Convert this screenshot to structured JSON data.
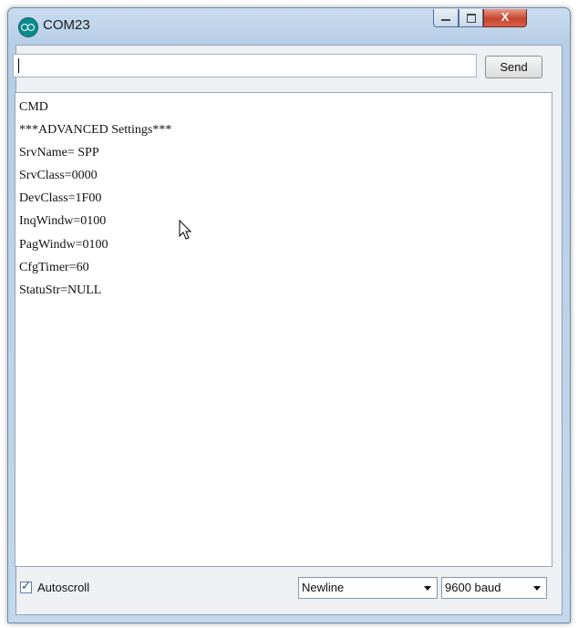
{
  "window": {
    "title": "COM23",
    "icon": "arduino-logo-icon",
    "controls": {
      "minimize": "minimize-icon",
      "maximize": "maximize-icon",
      "close": "X"
    }
  },
  "input": {
    "value": "",
    "send_label": "Send"
  },
  "output": {
    "lines": [
      "CMD",
      "***ADVANCED Settings***",
      "SrvName= SPP",
      "SrvClass=0000",
      "DevClass=1F00",
      "InqWindw=0100",
      "PagWindw=0100",
      "CfgTimer=60",
      "StatuStr=NULL"
    ]
  },
  "footer": {
    "autoscroll_label": "Autoscroll",
    "autoscroll_checked": true,
    "line_ending": "Newline",
    "baud_rate": "9600 baud"
  },
  "colors": {
    "title_bar": "#c3d8ec",
    "close_button": "#c6452c",
    "app_icon": "#0a8a8c"
  }
}
